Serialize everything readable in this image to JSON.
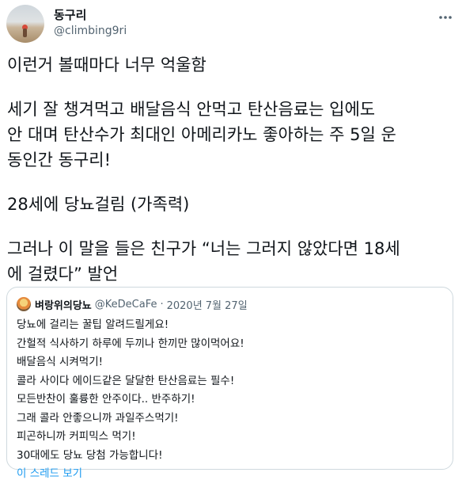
{
  "author": {
    "display_name": "동구리",
    "handle": "@climbing9ri"
  },
  "tweet": {
    "paragraphs": [
      [
        "이런거 볼때마다 너무 억울함"
      ],
      [
        "세기 잘 챙겨먹고 배달음식 안먹고 탄산음료는 입에도",
        "안 대며 탄산수가 최대인 아메리카노 좋아하는 주 5일 운",
        "동인간 동구리!"
      ],
      [
        "28세에 당뇨걸림 (가족력)"
      ],
      [
        "그러나 이 말을 들은 친구가 “너는 그러지 않았다면 18세",
        "에 걸렸다” 발언"
      ]
    ]
  },
  "quoted_tweet": {
    "display_name": "벼랑위의당뇨",
    "handle": "@KeDeCaFe",
    "separator": "·",
    "date": "2020년 7월 27일",
    "lines": [
      "당뇨에 걸리는 꿀팁 알려드릴게요!",
      "간헐적 식사하기 하루에 두끼나 한끼만 많이먹어요!",
      "배달음식 시켜먹기!",
      "콜라 사이다 에이드같은 달달한 탄산음료는 필수!",
      "모든반찬이 훌륭한 안주이다.. 반주하기!",
      "그래 콜라 안좋으니까 과일주스먹기!",
      "피곤하니까 커피믹스 먹기!",
      "30대에도 당뇨 당첨 가능합니다!"
    ],
    "show_thread": "이 스레드 보기"
  },
  "icons": {
    "more": "more-horizontal-icon"
  },
  "colors": {
    "link": "#1d9bf0",
    "secondary_text": "#536471",
    "border": "#cfd9de"
  }
}
